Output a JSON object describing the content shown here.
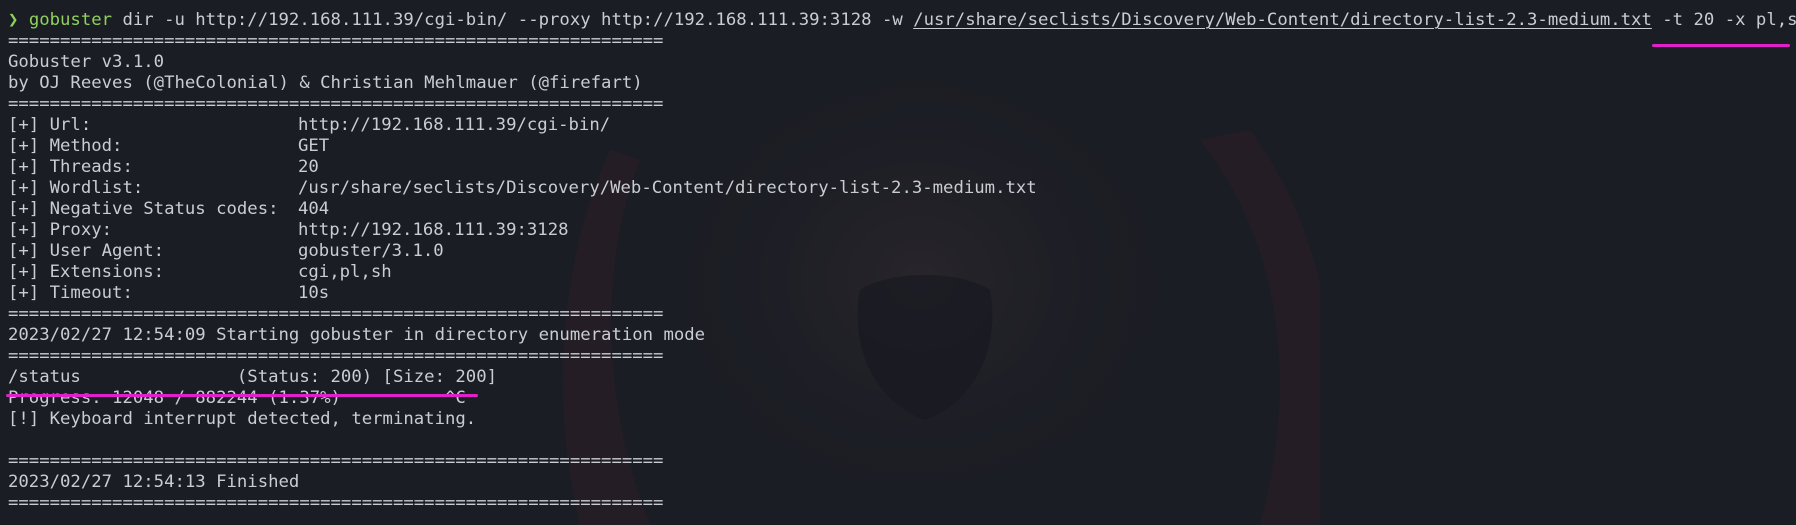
{
  "prompt": {
    "arrow": "❯",
    "command_name": "gobuster",
    "args_before_wordlist": " dir -u http://192.168.111.39/cgi-bin/ --proxy http://192.168.111.39:3128 -w ",
    "wordlist_path": "/usr/share/seclists/Discovery/Web-Content/directory-list-2.3-medium.txt",
    "args_threads": " -t 20 ",
    "args_extensions": "-x pl,sh,cgi"
  },
  "separator": "===============================================================",
  "banner": {
    "version": "Gobuster v3.1.0",
    "authors": "by OJ Reeves (@TheColonial) & Christian Mehlmauer (@firefart)"
  },
  "config": [
    {
      "label": "[+] Url:",
      "value": "http://192.168.111.39/cgi-bin/"
    },
    {
      "label": "[+] Method:",
      "value": "GET"
    },
    {
      "label": "[+] Threads:",
      "value": "20"
    },
    {
      "label": "[+] Wordlist:",
      "value": "/usr/share/seclists/Discovery/Web-Content/directory-list-2.3-medium.txt"
    },
    {
      "label": "[+] Negative Status codes:",
      "value": "404"
    },
    {
      "label": "[+] Proxy:",
      "value": "http://192.168.111.39:3128"
    },
    {
      "label": "[+] User Agent:",
      "value": "gobuster/3.1.0"
    },
    {
      "label": "[+] Extensions:",
      "value": "cgi,pl,sh"
    },
    {
      "label": "[+] Timeout:",
      "value": "10s"
    }
  ],
  "start_message": "2023/02/27 12:54:09 Starting gobuster in directory enumeration mode",
  "result": "/status               (Status: 200) [Size: 200]",
  "progress": "Progress: 12048 / 882244 (1.37%)          ^C",
  "interrupt": "[!] Keyboard interrupt detected, terminating.",
  "finished": "2023/02/27 12:54:13 Finished",
  "colors": {
    "background": "#1b1d24",
    "text": "#c9ccd3",
    "prompt": "#8fd15a",
    "highlight": "#e020c8"
  }
}
